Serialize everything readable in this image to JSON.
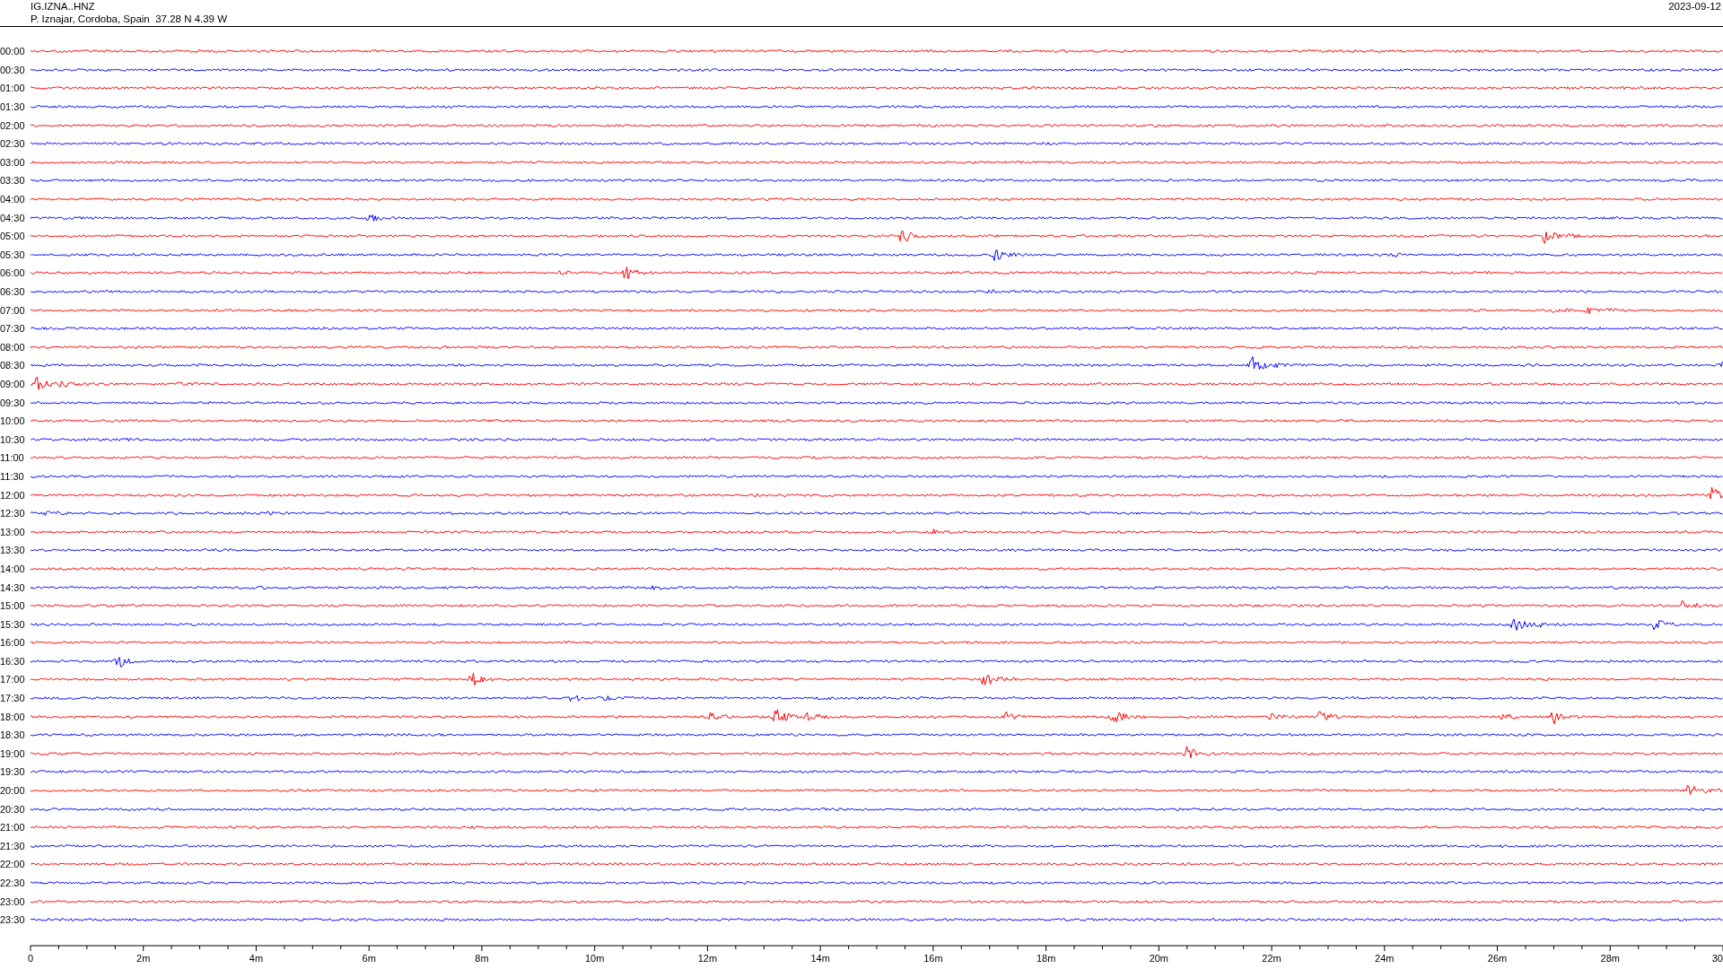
{
  "header": {
    "channel": "IG.IZNA..HNZ",
    "station": "P. Iznajar, Cordoba, Spain  37.28 N 4.39 W",
    "date": "2023-09-12"
  },
  "rows": [
    {
      "time": "00:00",
      "color": "#ff0000"
    },
    {
      "time": "00:30",
      "color": "#0000ff"
    },
    {
      "time": "01:00",
      "color": "#ff0000"
    },
    {
      "time": "01:30",
      "color": "#0000ff"
    },
    {
      "time": "02:00",
      "color": "#ff0000"
    },
    {
      "time": "02:30",
      "color": "#0000ff"
    },
    {
      "time": "03:00",
      "color": "#ff0000"
    },
    {
      "time": "03:30",
      "color": "#0000ff"
    },
    {
      "time": "04:00",
      "color": "#ff0000"
    },
    {
      "time": "04:30",
      "color": "#0000ff"
    },
    {
      "time": "05:00",
      "color": "#ff0000"
    },
    {
      "time": "05:30",
      "color": "#0000ff"
    },
    {
      "time": "06:00",
      "color": "#ff0000"
    },
    {
      "time": "06:30",
      "color": "#0000ff"
    },
    {
      "time": "07:00",
      "color": "#ff0000"
    },
    {
      "time": "07:30",
      "color": "#0000ff"
    },
    {
      "time": "08:00",
      "color": "#ff0000"
    },
    {
      "time": "08:30",
      "color": "#0000ff"
    },
    {
      "time": "09:00",
      "color": "#ff0000"
    },
    {
      "time": "09:30",
      "color": "#0000ff"
    },
    {
      "time": "10:00",
      "color": "#ff0000"
    },
    {
      "time": "10:30",
      "color": "#0000ff"
    },
    {
      "time": "11:00",
      "color": "#ff0000"
    },
    {
      "time": "11:30",
      "color": "#0000ff"
    },
    {
      "time": "12:00",
      "color": "#ff0000"
    },
    {
      "time": "12:30",
      "color": "#0000ff"
    },
    {
      "time": "13:00",
      "color": "#ff0000"
    },
    {
      "time": "13:30",
      "color": "#0000ff"
    },
    {
      "time": "14:00",
      "color": "#ff0000"
    },
    {
      "time": "14:30",
      "color": "#0000ff"
    },
    {
      "time": "15:00",
      "color": "#ff0000"
    },
    {
      "time": "15:30",
      "color": "#0000ff"
    },
    {
      "time": "16:00",
      "color": "#ff0000"
    },
    {
      "time": "16:30",
      "color": "#0000ff"
    },
    {
      "time": "17:00",
      "color": "#ff0000"
    },
    {
      "time": "17:30",
      "color": "#0000ff"
    },
    {
      "time": "18:00",
      "color": "#ff0000"
    },
    {
      "time": "18:30",
      "color": "#0000ff"
    },
    {
      "time": "19:00",
      "color": "#ff0000"
    },
    {
      "time": "19:30",
      "color": "#0000ff"
    },
    {
      "time": "20:00",
      "color": "#ff0000"
    },
    {
      "time": "20:30",
      "color": "#0000ff"
    },
    {
      "time": "21:00",
      "color": "#ff0000"
    },
    {
      "time": "21:30",
      "color": "#0000ff"
    },
    {
      "time": "22:00",
      "color": "#ff0000"
    },
    {
      "time": "22:30",
      "color": "#0000ff"
    },
    {
      "time": "23:00",
      "color": "#ff0000"
    },
    {
      "time": "23:30",
      "color": "#0000ff"
    }
  ],
  "axis": {
    "tick_labels": [
      "0",
      "2m",
      "4m",
      "6m",
      "8m",
      "10m",
      "12m",
      "14m",
      "16m",
      "18m",
      "20m",
      "22m",
      "24m",
      "26m",
      "28m",
      "30"
    ]
  }
}
